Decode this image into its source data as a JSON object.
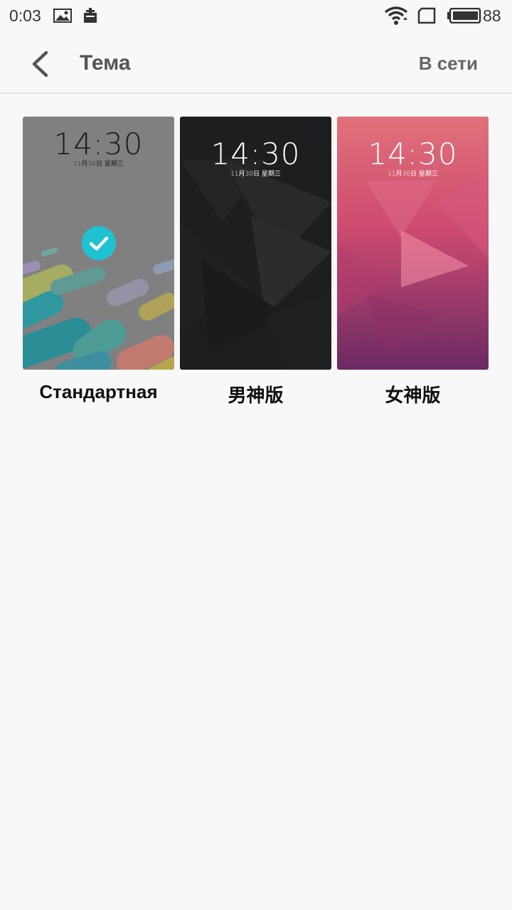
{
  "status_bar": {
    "time": "0:03",
    "battery_level": "88",
    "icons": [
      "image-icon",
      "notification-icon",
      "wifi-icon",
      "sim-icon",
      "battery-icon"
    ]
  },
  "header": {
    "back_icon": "chevron-left-icon",
    "title": "Тема",
    "online_label": "В сети"
  },
  "themes": [
    {
      "name": "Стандартная",
      "clock": "14:30",
      "date": "11月30日  星期三",
      "selected": true,
      "clock_color": "#1b1b1b",
      "bg": "#7f7f7f"
    },
    {
      "name": "男神版",
      "clock": "14:30",
      "date": "11月30日  星期三",
      "selected": false,
      "clock_color": "#ffffff",
      "bg": "#1d1e1f"
    },
    {
      "name": "女神版",
      "clock": "14:30",
      "date": "11月30日  星期三",
      "selected": false,
      "clock_color": "#ffffff",
      "bg": "#c8476b"
    }
  ],
  "colors": {
    "accent": "#1fc2d3",
    "background": "#f8f8f8"
  }
}
